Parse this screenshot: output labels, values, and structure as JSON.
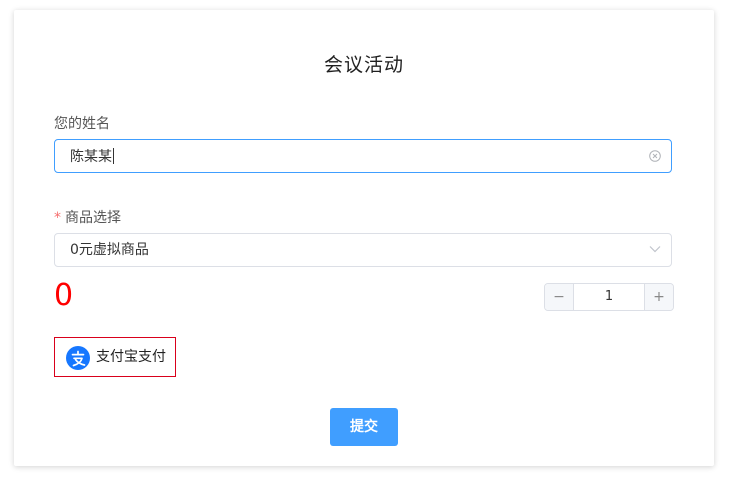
{
  "form": {
    "title": "会议活动",
    "name_label": "您的姓名",
    "name_value": "陈某某",
    "product_required_mark": "*",
    "product_label": "商品选择",
    "product_selected": "0元虚拟商品",
    "price": "0",
    "quantity": "1",
    "stepper_minus": "−",
    "stepper_plus": "+",
    "payment_method_label": "支付宝支付",
    "submit_label": "提交"
  },
  "icons": {
    "clear": "circle-close-icon",
    "dropdown": "chevron-down-icon",
    "payment": "alipay-logo-icon"
  },
  "colors": {
    "accent": "#409eff",
    "price": "#ff0000",
    "payment_border": "#d9001b",
    "required": "#f56c6c",
    "alipay": "#1677ff"
  }
}
